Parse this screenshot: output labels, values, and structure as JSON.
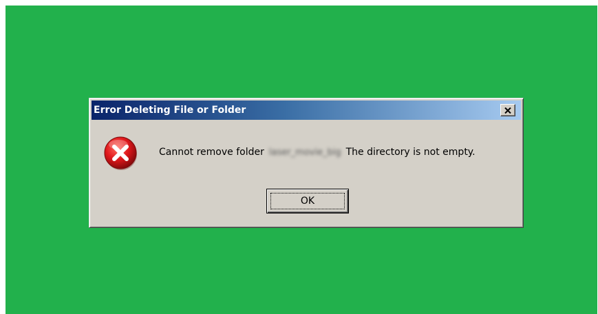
{
  "dialog": {
    "title": "Error Deleting File or Folder",
    "close_label": "✕",
    "icon": "error-icon",
    "message_prefix": "Cannot remove folder",
    "folder_name_blurred": "laser_movie_big",
    "message_suffix": "The directory is not empty.",
    "ok_label": "OK"
  },
  "colors": {
    "desktop": "#22b14c",
    "dialog_face": "#d4d0c8",
    "title_start": "#0a246a",
    "title_end": "#a6caf0",
    "error_red": "#e0181c"
  }
}
